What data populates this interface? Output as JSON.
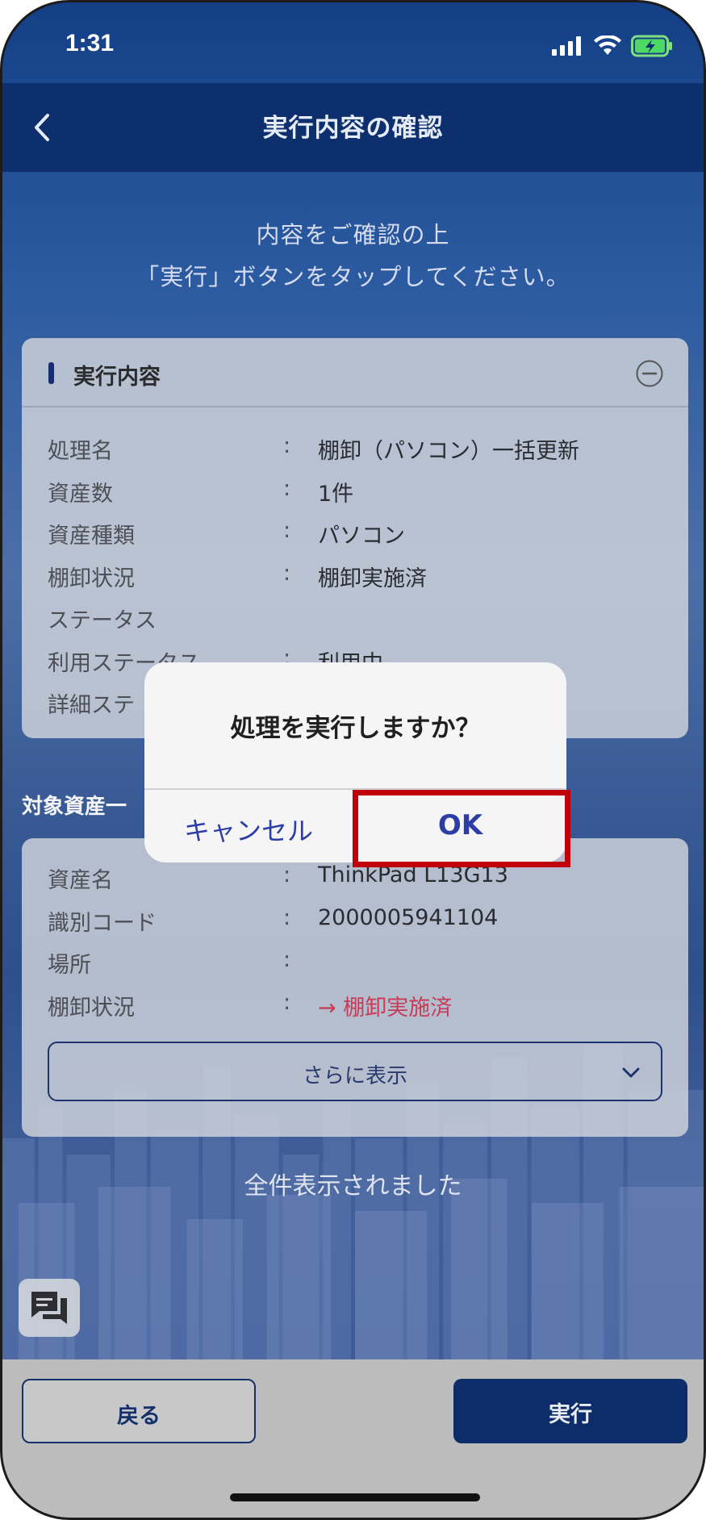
{
  "status_bar": {
    "time": "1:31"
  },
  "header": {
    "title": "実行内容の確認"
  },
  "intro": {
    "line1": "内容をご確認の上",
    "line2": "「実行」ボタンをタップしてください。"
  },
  "exec_card": {
    "title": "実行内容",
    "rows": [
      {
        "label": "処理名",
        "colon": ":",
        "value": "棚卸（パソコン）一括更新"
      },
      {
        "label": "資産数",
        "colon": ":",
        "value": "1件"
      },
      {
        "label": "資産種類",
        "colon": ":",
        "value": "パソコン"
      },
      {
        "label": "棚卸状況",
        "colon": ":",
        "value": "棚卸実施済"
      },
      {
        "label": "ステータス",
        "colon": "",
        "value": ""
      },
      {
        "label": "利用ステータス",
        "colon": ":",
        "value": "利用中"
      },
      {
        "label": "詳細ステ",
        "colon": "",
        "value": ""
      }
    ]
  },
  "asset_section": {
    "title": "対象資産一"
  },
  "asset_card": {
    "rows": [
      {
        "label": "資産名",
        "colon": ":",
        "value": "ThinkPad L13G13"
      },
      {
        "label": "識別コード",
        "colon": ":",
        "value": "2000005941104"
      },
      {
        "label": "場所",
        "colon": ":",
        "value": ""
      },
      {
        "label": "棚卸状況",
        "colon": ":",
        "value": "→ 棚卸実施済"
      }
    ],
    "more_label": "さらに表示"
  },
  "footer_note": "全件表示されました",
  "bottom_bar": {
    "back_label": "戻る",
    "exec_label": "実行"
  },
  "dialog": {
    "message": "処理を実行しますか？",
    "cancel_label": "キャンセル",
    "ok_label": "OK"
  },
  "colors": {
    "navy": "#0d2f6d",
    "accent_red": "#c83a55",
    "dialog_button": "#2c3ea6",
    "highlight": "#c0000b"
  },
  "icons": {
    "back": "chevron-left-icon",
    "collapse": "minus-circle-icon",
    "more": "chevron-down-icon",
    "chat": "chat-bubbles-icon"
  }
}
